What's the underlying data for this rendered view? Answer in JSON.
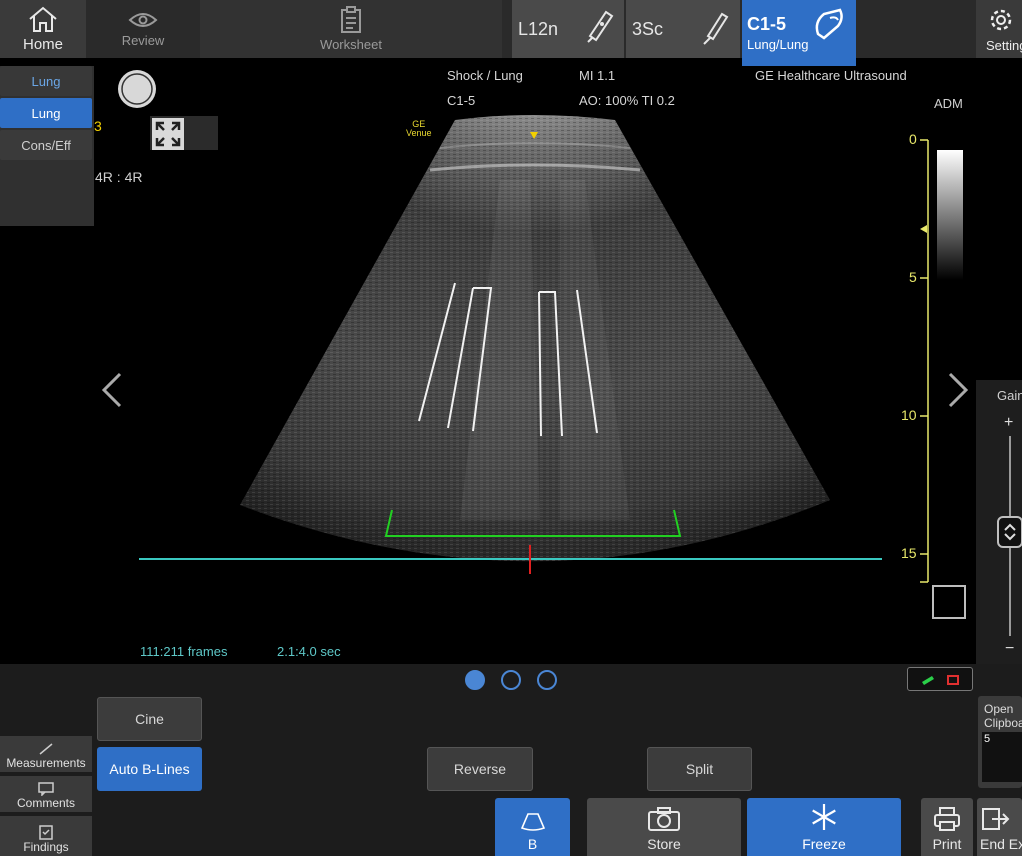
{
  "topbar": {
    "home_label": "Home",
    "review_label": "Review",
    "worksheet_label": "Worksheet",
    "settings_label": "Settings",
    "probes": [
      {
        "label": "L12n"
      },
      {
        "label": "3Sc"
      },
      {
        "label": "C1-5",
        "sub": "Lung/Lung"
      }
    ]
  },
  "presets": {
    "header": "Lung",
    "selected": "Lung",
    "other": "Cons/Eff"
  },
  "image_info": {
    "marker_3": "3",
    "ratio": "4R : 4R",
    "preset_name": "Shock / Lung",
    "probe": "C1-5",
    "mi": "MI 1.1",
    "ao_ti": "AO: 100% TI 0.2",
    "manufacturer": "GE Healthcare Ultrasound",
    "venue_brand": "GE",
    "venue_model": "Venue",
    "adm": "ADM",
    "depth_marks": [
      "0",
      "5",
      "10",
      "15"
    ],
    "frames": "111:211 frames",
    "seconds": "2.1:4.0 sec"
  },
  "gain": {
    "label": "Gain",
    "plus": "+",
    "minus": "−"
  },
  "bottom": {
    "cine_label": "Cine",
    "auto_blines_label": "Auto B-Lines",
    "reverse_label": "Reverse",
    "split_label": "Split",
    "measurements_label": "Measurements",
    "comments_label": "Comments",
    "findings_label": "Findings",
    "b_mode_label": "B",
    "store_label": "Store",
    "freeze_label": "Freeze",
    "print_label": "Print",
    "end_exam_label": "End Exam",
    "clipboard_label_1": "Open",
    "clipboard_label_2": "Clipboard",
    "clipboard_count": "5"
  },
  "colors": {
    "accent": "#2f6fc6",
    "depth_scale": "#e8e86a",
    "baseline": "#3ac8c0",
    "roi": "#22d022",
    "marker": "#e02020",
    "info_text": "#5ec8c8"
  }
}
